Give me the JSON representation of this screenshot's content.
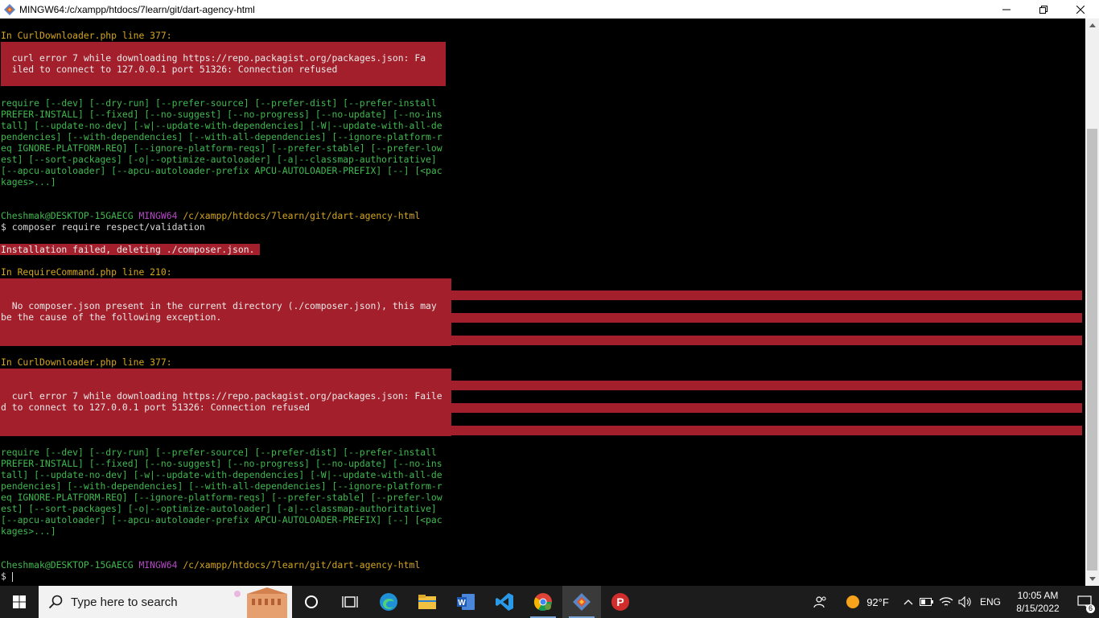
{
  "window": {
    "title": "MINGW64:/c/xampp/htdocs/7learn/git/dart-agency-html"
  },
  "terminal": {
    "lines": [
      {
        "text": "In CurlDownloader.php line 377:",
        "color": "y"
      },
      {
        "text": "  curl error 7 while downloading https://repo.packagist.org/packages.json: Fa",
        "color": "wt"
      },
      {
        "text": "  iled to connect to 127.0.0.1 port 51326: Connection refused",
        "color": "wt"
      },
      {
        "text": "require [--dev] [--dry-run] [--prefer-source] [--prefer-dist] [--prefer-install",
        "color": "g"
      },
      {
        "text": "PREFER-INSTALL] [--fixed] [--no-suggest] [--no-progress] [--no-update] [--no-ins",
        "color": "g"
      },
      {
        "text": "tall] [--update-no-dev] [-w|--update-with-dependencies] [-W|--update-with-all-de",
        "color": "g"
      },
      {
        "text": "pendencies] [--with-dependencies] [--with-all-dependencies] [--ignore-platform-r",
        "color": "g"
      },
      {
        "text": "eq IGNORE-PLATFORM-REQ] [--ignore-platform-reqs] [--prefer-stable] [--prefer-low",
        "color": "g"
      },
      {
        "text": "est] [--sort-packages] [-o|--optimize-autoloader] [-a|--classmap-authoritative]",
        "color": "g"
      },
      {
        "text": "[--apcu-autoloader] [--apcu-autoloader-prefix APCU-AUTOLOADER-PREFIX] [--] [<pac",
        "color": "g"
      },
      {
        "text": "kages>...]",
        "color": "g"
      },
      {
        "user": "Cheshmak@DESKTOP-15GAECG",
        "sys": "MINGW64",
        "path": "/c/xampp/htdocs/7learn/git/dart-agency-html"
      },
      {
        "text": "$ composer require respect/validation",
        "color": "w"
      },
      {
        "text": "Installation failed, deleting ./composer.json.",
        "color": "wt"
      },
      {
        "text": "In RequireCommand.php line 210:",
        "color": "y"
      },
      {
        "text": "  No composer.json present in the current directory (./composer.json), this may",
        "color": "wt"
      },
      {
        "text": "be the cause of the following exception.",
        "color": "wt"
      },
      {
        "text": "In CurlDownloader.php line 377:",
        "color": "y"
      },
      {
        "text": "  curl error 7 while downloading https://repo.packagist.org/packages.json: Faile",
        "color": "wt"
      },
      {
        "text": "d to connect to 127.0.0.1 port 51326: Connection refused",
        "color": "wt"
      },
      {
        "text": "require [--dev] [--dry-run] [--prefer-source] [--prefer-dist] [--prefer-install",
        "color": "g"
      },
      {
        "text": "PREFER-INSTALL] [--fixed] [--no-suggest] [--no-progress] [--no-update] [--no-ins",
        "color": "g"
      },
      {
        "text": "tall] [--update-no-dev] [-w|--update-with-dependencies] [-W|--update-with-all-de",
        "color": "g"
      },
      {
        "text": "pendencies] [--with-dependencies] [--with-all-dependencies] [--ignore-platform-r",
        "color": "g"
      },
      {
        "text": "eq IGNORE-PLATFORM-REQ] [--ignore-platform-reqs] [--prefer-stable] [--prefer-low",
        "color": "g"
      },
      {
        "text": "est] [--sort-packages] [-o|--optimize-autoloader] [-a|--classmap-authoritative]",
        "color": "g"
      },
      {
        "text": "[--apcu-autoloader] [--apcu-autoloader-prefix APCU-AUTOLOADER-PREFIX] [--] [<pac",
        "color": "g"
      },
      {
        "text": "kages>...]",
        "color": "g"
      },
      {
        "user": "Cheshmak@DESKTOP-15GAECG",
        "sys": "MINGW64",
        "path": "/c/xampp/htdocs/7learn/git/dart-agency-html"
      },
      {
        "text": "$ ",
        "color": "w",
        "cursor": true
      }
    ]
  },
  "taskbar": {
    "search_placeholder": "Type here to search",
    "weather": "92°F",
    "language": "ENG",
    "time": "10:05 AM",
    "date": "8/15/2022",
    "notification_count": "6"
  },
  "colors": {
    "error_bg": "#a31f2b",
    "yellow": "#d4a61d",
    "green": "#3fb94f",
    "magenta": "#b548c6"
  }
}
